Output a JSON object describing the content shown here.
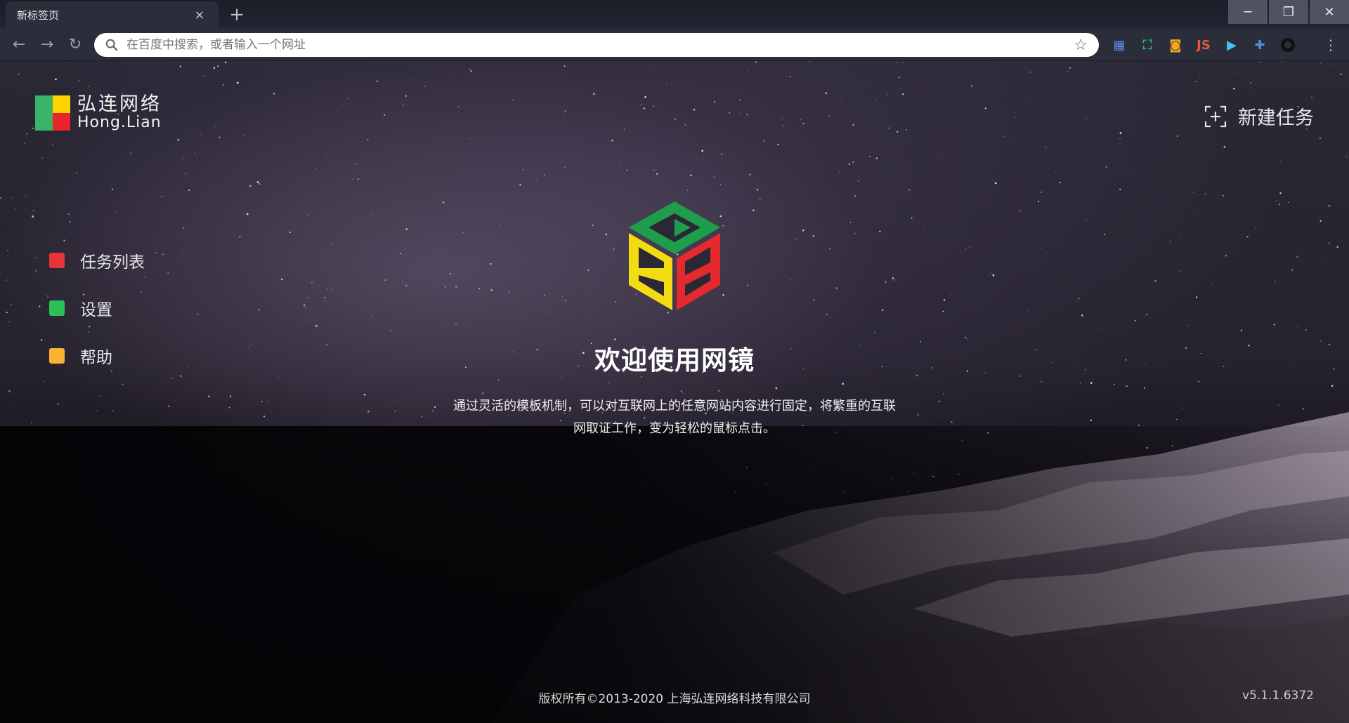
{
  "browser": {
    "tab": {
      "title": "新标签页",
      "close": "×"
    },
    "new_tab": "+",
    "window_controls": {
      "minimize": "─",
      "restore": "❐",
      "close": "✕"
    },
    "nav": {
      "back": "←",
      "forward": "→",
      "reload": "↻"
    },
    "omnibox": {
      "placeholder": "在百度中搜索，或者输入一个网址",
      "star": "☆"
    },
    "extensions": [
      {
        "name": "apps-grid-icon",
        "glyph": "▦",
        "color": "#5f8ee8"
      },
      {
        "name": "screen-capture-icon",
        "glyph": "⛶",
        "color": "#2bb673"
      },
      {
        "name": "camera-icon",
        "glyph": "◙",
        "color": "#f5a623"
      },
      {
        "name": "js-icon",
        "glyph": "JS",
        "color": "#e8563f"
      },
      {
        "name": "video-icon",
        "glyph": "▶",
        "color": "#3ec7f0"
      },
      {
        "name": "puzzle-icon",
        "glyph": "✚",
        "color": "#4a90e2"
      },
      {
        "name": "record-icon",
        "glyph": "●",
        "color": "#111111"
      }
    ],
    "menu": "⋮"
  },
  "app": {
    "logo": {
      "cn": "弘连网络",
      "en": "Hong.Lian"
    },
    "new_task": "新建任务",
    "nav_items": [
      {
        "label": "任务列表",
        "color": "#e8323c"
      },
      {
        "label": "设置",
        "color": "#2fbf58"
      },
      {
        "label": "帮助",
        "color": "#f9b233"
      }
    ],
    "hero": {
      "title": "欢迎使用网镜",
      "desc_line1": "通过灵活的模板机制，可以对互联网上的任意网站内容进行固定，将繁重的互联",
      "desc_line2": "网取证工作，变为轻松的鼠标点击。"
    },
    "footer": {
      "copyright": "版权所有©2013-2020 上海弘连网络科技有限公司",
      "version": "v5.1.1.6372"
    }
  }
}
